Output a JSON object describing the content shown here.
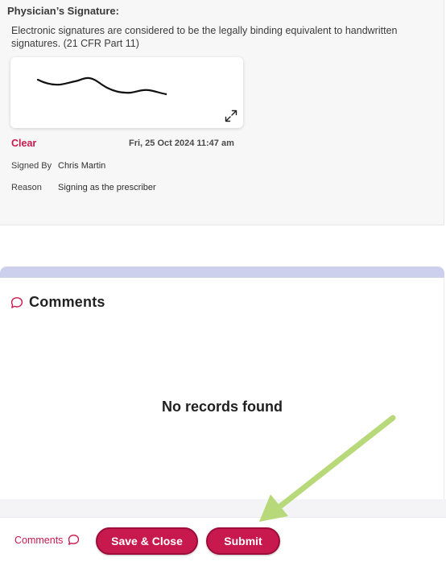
{
  "signature": {
    "title": "Physician’s Signature:",
    "description": "Electronic signatures are considered to be the legally binding equivalent to handwritten signatures. (21 CFR Part 11)",
    "clear_label": "Clear",
    "timestamp": "Fri, 25 Oct 2024 11:47 am",
    "signed_by_label": "Signed By",
    "signed_by_value": "Chris Martin",
    "reason_label": "Reason",
    "reason_value": "Signing as the prescriber",
    "expand_icon": "expand-icon"
  },
  "comments": {
    "title": "Comments",
    "empty_message": "No records found",
    "icon": "chat-bubble-icon"
  },
  "footer": {
    "comments_label": "Comments",
    "save_close_label": "Save & Close",
    "submit_label": "Submit"
  },
  "colors": {
    "accent": "#c8194f",
    "band": "#cdd0ec",
    "arrow": "#b7d97a"
  }
}
